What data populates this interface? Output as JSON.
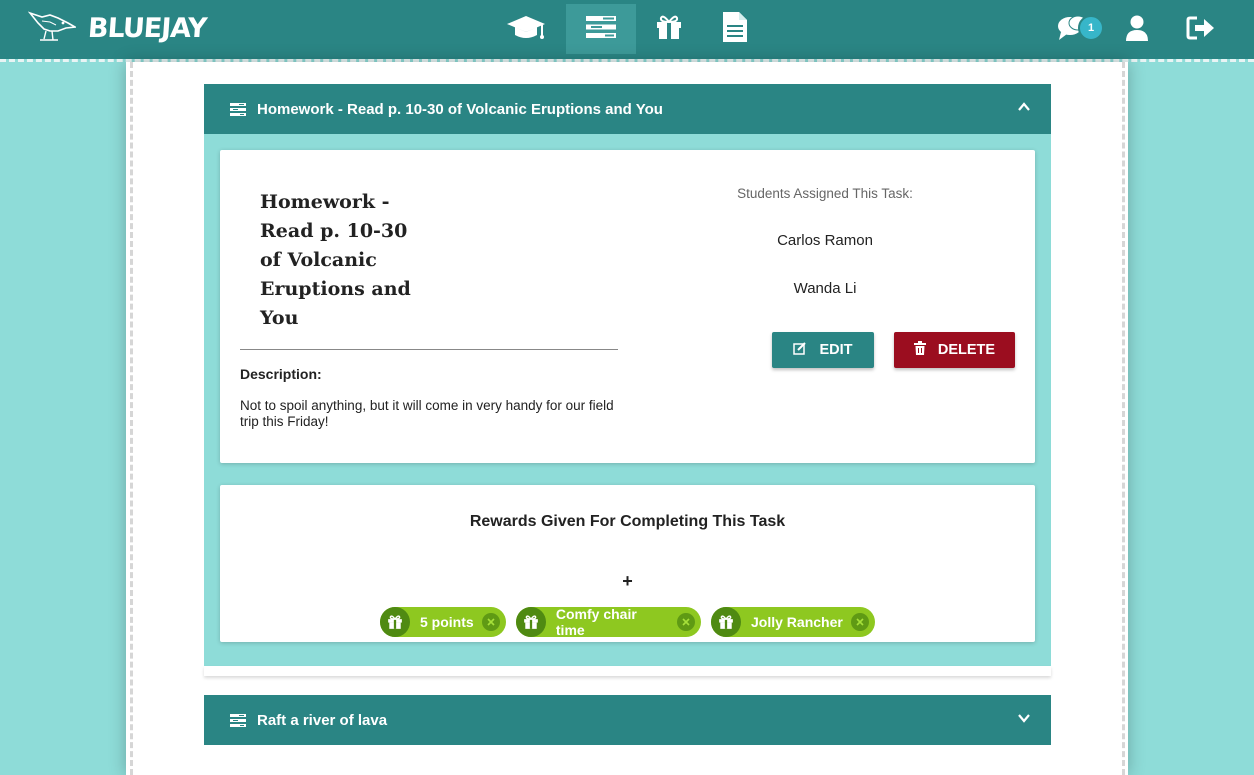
{
  "app": {
    "brand": "BLUEJAY"
  },
  "nav": {
    "items": [
      {
        "name": "classes",
        "icon": "graduation-cap-icon"
      },
      {
        "name": "tasks",
        "icon": "tasks-list-icon",
        "active": true
      },
      {
        "name": "rewards",
        "icon": "gift-icon"
      },
      {
        "name": "reports",
        "icon": "document-icon"
      }
    ]
  },
  "header_right": {
    "messages_badge": "1"
  },
  "tasks": [
    {
      "title": "Homework - Read p. 10-30 of Volcanic Eruptions and You",
      "expanded": true,
      "detail_title": "Homework - Read p. 10-30 of Volcanic Eruptions and You",
      "description_label": "Description:",
      "description": "Not to spoil anything, but it will come in very handy for our field trip this Friday!",
      "assigned_label": "Students Assigned This Task:",
      "students": [
        "Carlos Ramon",
        "Wanda Li"
      ],
      "edit_label": "EDIT",
      "delete_label": "DELETE",
      "rewards_title": "Rewards Given For Completing This Task",
      "add_symbol": "+",
      "rewards": [
        "5 points",
        "Comfy chair time",
        "Jolly Rancher"
      ]
    },
    {
      "title": "Raft a river of lava",
      "expanded": false
    }
  ],
  "colors": {
    "primary": "#2a8584",
    "background": "#8edcd8",
    "delete": "#9b0d1f",
    "chip": "#8ec820",
    "chip_dark": "#4f8a12",
    "badge": "#37b6c9"
  }
}
